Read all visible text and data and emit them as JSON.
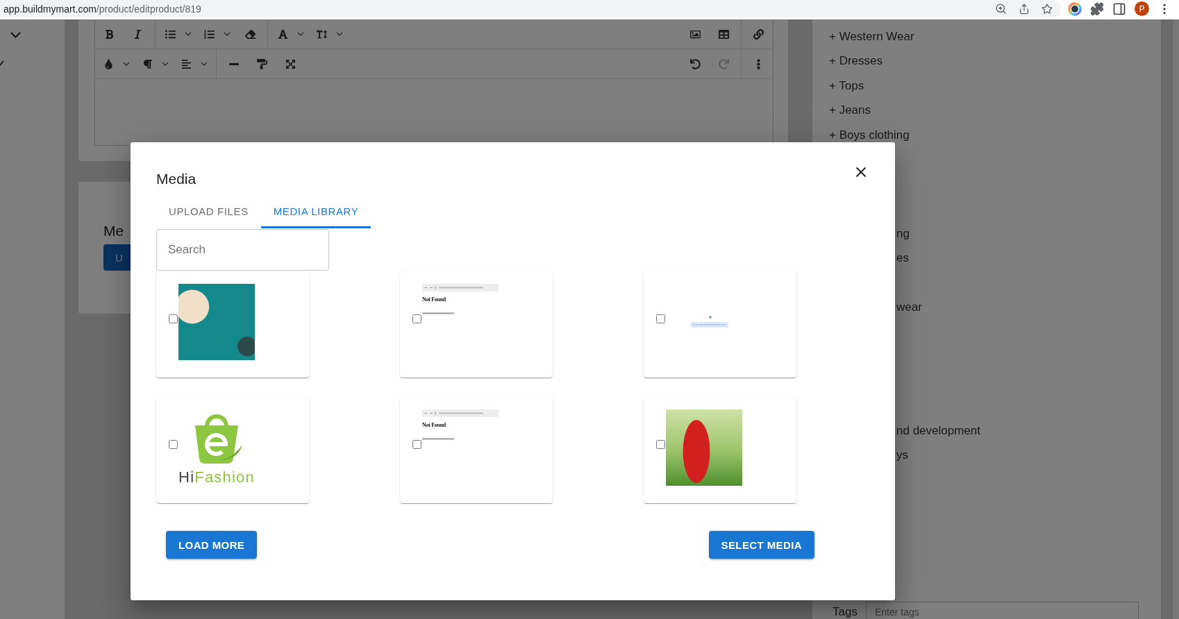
{
  "browser": {
    "url_host": "app.buildmymart.com",
    "url_path": "/product/editproduct/819",
    "profile_initial": "P"
  },
  "editor": {
    "history": [
      {
        "kind": "undo",
        "disabled": false
      },
      {
        "kind": "redo",
        "disabled": true
      }
    ]
  },
  "media_card": {
    "heading": "Me",
    "button": "U"
  },
  "categories": {
    "items": [
      "+ Western Wear",
      "+ Dresses",
      "+ Tops",
      "+ Jeans",
      "+ Boys clothing"
    ],
    "partly_covered": [
      "ng",
      "es",
      "wear",
      "nd development",
      "ys"
    ]
  },
  "tags": {
    "label": "Tags",
    "placeholder": "Enter tags"
  },
  "dialog": {
    "title": "Media",
    "tabs": [
      {
        "label": "UPLOAD FILES",
        "selected": false
      },
      {
        "label": "MEDIA LIBRARY",
        "selected": true
      }
    ],
    "search": {
      "placeholder": "Search"
    },
    "media_items": [
      {
        "kind": "banner",
        "checked": false
      },
      {
        "kind": "screenshot",
        "checked": false,
        "heading": "Not Found"
      },
      {
        "kind": "notice",
        "checked": false
      },
      {
        "kind": "logo",
        "checked": false,
        "brand_start": "Hi",
        "brand_end": "Fashion"
      },
      {
        "kind": "screenshot",
        "checked": false,
        "heading": "Not Found"
      },
      {
        "kind": "photo",
        "checked": false
      }
    ],
    "load_more": "LOAD MORE",
    "select": "SELECT MEDIA"
  }
}
